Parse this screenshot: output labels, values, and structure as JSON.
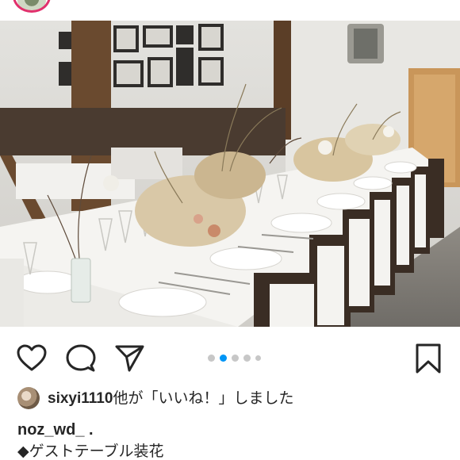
{
  "post": {
    "carousel": {
      "count": 5,
      "active_index": 1
    },
    "likes": {
      "user": "sixyi1110",
      "suffix": "他が「いいね！」しました"
    },
    "author": "noz_wd_ .",
    "caption_line": "◆ゲストテーブル装花"
  },
  "icons": {
    "like": "heart-icon",
    "comment": "comment-bubble-icon",
    "share": "paper-plane-icon",
    "save": "bookmark-icon"
  },
  "colors": {
    "active_dot": "#0095f6",
    "inactive_dot": "#c7c7c7",
    "story_ring": "#e1306c"
  }
}
